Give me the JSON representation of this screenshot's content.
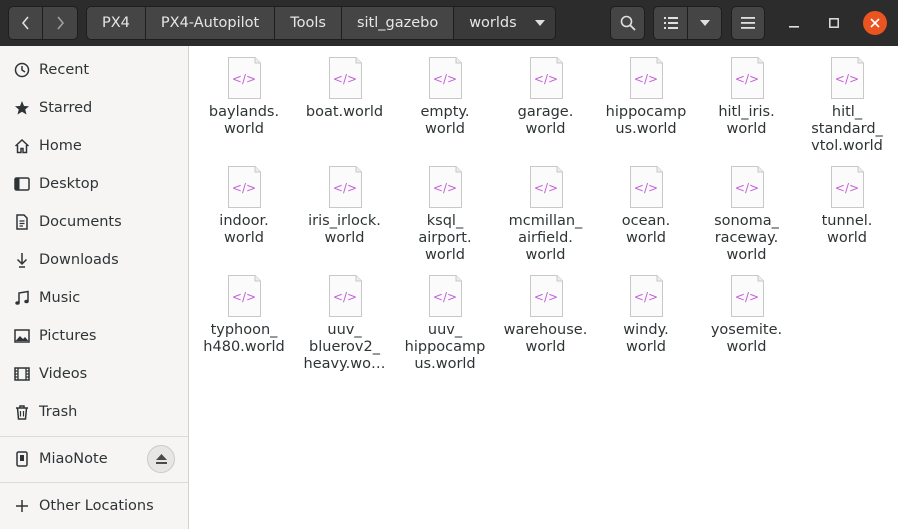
{
  "header": {
    "breadcrumbs": [
      "PX4",
      "PX4-Autopilot",
      "Tools",
      "sitl_gazebo",
      "worlds"
    ],
    "accent_color": "#e95420"
  },
  "sidebar": {
    "items": [
      {
        "label": "Recent",
        "icon": "clock-icon"
      },
      {
        "label": "Starred",
        "icon": "star-icon"
      },
      {
        "label": "Home",
        "icon": "home-icon"
      },
      {
        "label": "Desktop",
        "icon": "desktop-icon"
      },
      {
        "label": "Documents",
        "icon": "document-icon"
      },
      {
        "label": "Downloads",
        "icon": "download-icon"
      },
      {
        "label": "Music",
        "icon": "music-icon"
      },
      {
        "label": "Pictures",
        "icon": "picture-icon"
      },
      {
        "label": "Videos",
        "icon": "video-icon"
      },
      {
        "label": "Trash",
        "icon": "trash-icon"
      }
    ],
    "devices": [
      {
        "label": "MiaoNote",
        "icon": "usb-drive-icon"
      }
    ],
    "other": {
      "label": "Other Locations",
      "icon": "plus-icon"
    }
  },
  "files": [
    {
      "name": "baylands.\nworld"
    },
    {
      "name": "boat.world"
    },
    {
      "name": "empty.\nworld"
    },
    {
      "name": "garage.\nworld"
    },
    {
      "name": "hippocamp\nus.world"
    },
    {
      "name": "hitl_iris.\nworld"
    },
    {
      "name": "hitl_\nstandard_\nvtol.world"
    },
    {
      "name": "indoor.\nworld"
    },
    {
      "name": "iris_irlock.\nworld"
    },
    {
      "name": "ksql_\nairport.\nworld"
    },
    {
      "name": "mcmillan_\nairfield.\nworld"
    },
    {
      "name": "ocean.\nworld"
    },
    {
      "name": "sonoma_\nraceway.\nworld"
    },
    {
      "name": "tunnel.\nworld"
    },
    {
      "name": "typhoon_\nh480.world"
    },
    {
      "name": "uuv_\nbluerov2_\nheavy.wo…"
    },
    {
      "name": "uuv_\nhippocamp\nus.world"
    },
    {
      "name": "warehouse.\nworld"
    },
    {
      "name": "windy.\nworld"
    },
    {
      "name": "yosemite.\nworld"
    }
  ]
}
